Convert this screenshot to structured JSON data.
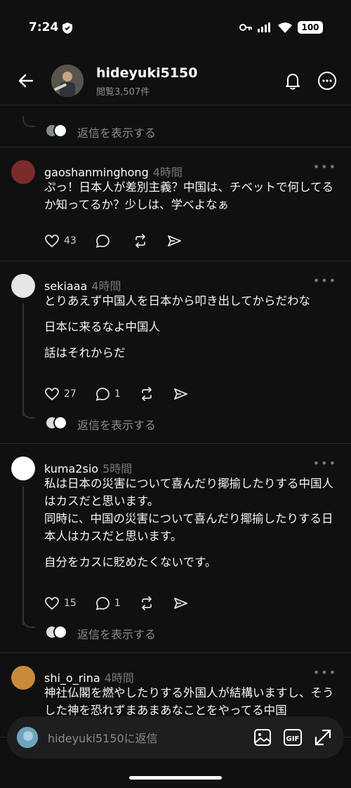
{
  "status_bar": {
    "time": "7:24",
    "battery": "100"
  },
  "header": {
    "title": "hideyuki5150",
    "views": "閲覧3,507件"
  },
  "top_partial": {
    "show_replies": "返信を表示する"
  },
  "posts": [
    {
      "username": "gaoshanminghong",
      "time": "4時間",
      "paragraphs": [
        "ぷっ！日本人が差別主義？中国は、チベットで何してるか知ってるか？少しは、学べよなぁ"
      ],
      "likes": "43",
      "replies": ""
    },
    {
      "username": "sekiaaa",
      "time": "4時間",
      "paragraphs": [
        "とりあえず中国人を日本から叩き出してからだわな",
        "日本に来るなよ中国人",
        "話はそれからだ"
      ],
      "likes": "27",
      "replies": "1",
      "show_replies": "返信を表示する"
    },
    {
      "username": "kuma2sio",
      "time": "5時間",
      "paragraphs": [
        "私は日本の災害について喜んだり揶揄したりする中国人はカスだと思います。\n同時に、中国の災害について喜んだり揶揄したりする日本人はカスだと思います。",
        "自分をカスに貶めたくないです。"
      ],
      "likes": "15",
      "replies": "1",
      "show_replies": "返信を表示する"
    },
    {
      "username": "shi_o_rina",
      "time": "4時間",
      "paragraphs": [
        "神社仏閣を燃やしたりする外国人が結構いますし、そうした神を恐れずまあまあなことをやってる中国"
      ]
    }
  ],
  "composer": {
    "placeholder": "hideyuki5150に返信"
  },
  "icons": {
    "back": "arrow-left-icon",
    "bell": "bell-icon",
    "more": "more-circle-icon",
    "like": "heart-icon",
    "reply": "comment-icon",
    "repost": "repost-icon",
    "share": "send-icon",
    "image": "image-icon",
    "gif": "gif-icon",
    "expand": "expand-icon"
  }
}
